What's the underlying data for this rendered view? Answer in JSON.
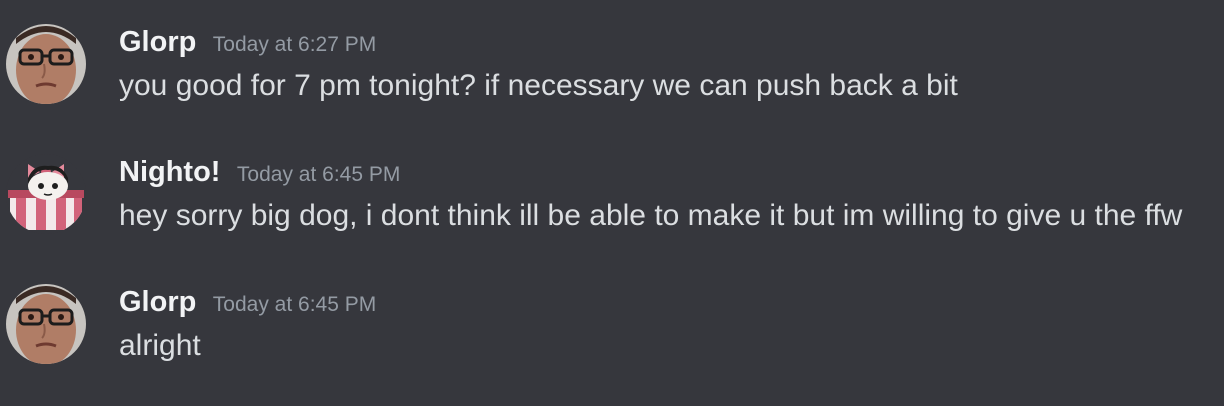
{
  "messages": [
    {
      "author": "Glorp",
      "timestamp": "Today at 6:27 PM",
      "content": "you good for 7 pm tonight? if necessary we can push back a bit",
      "avatar_icon": "glorp-photo-avatar"
    },
    {
      "author": "Nighto!",
      "timestamp": "Today at 6:45 PM",
      "content": "hey sorry big dog, i dont think ill be able to make it but im willing to give u the ffw",
      "avatar_icon": "anime-gift-box-avatar"
    },
    {
      "author": "Glorp",
      "timestamp": "Today at 6:45 PM",
      "content": "alright",
      "avatar_icon": "glorp-photo-avatar"
    }
  ],
  "colors": {
    "background": "#36373d",
    "author": "#f2f3f5",
    "timestamp": "#949ba4",
    "content": "#dbdee1"
  }
}
